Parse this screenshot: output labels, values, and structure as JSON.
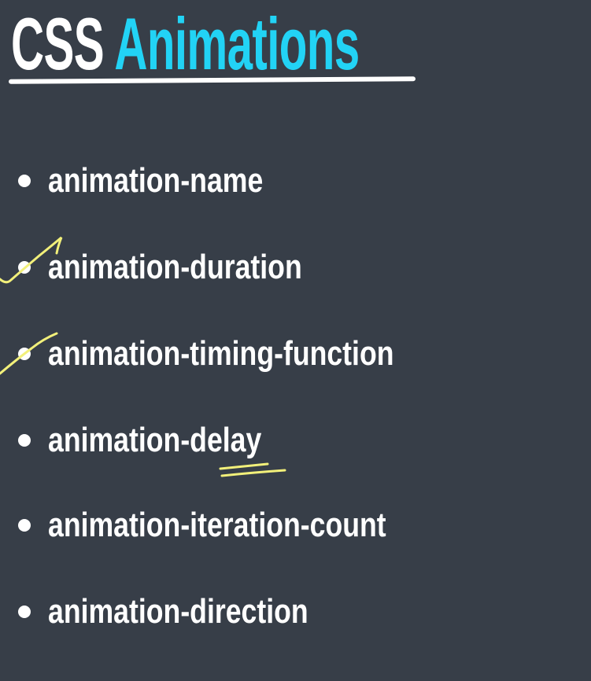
{
  "slide": {
    "title_part1": "CSS",
    "title_part2": "Animations",
    "accent_color": "#22d3f5",
    "annotation_color": "#f2f07a",
    "items": [
      {
        "label": "animation-name",
        "checked": false
      },
      {
        "label": "animation-duration",
        "checked": true
      },
      {
        "label": "animation-timing-function",
        "checked": true
      },
      {
        "label": "animation-delay",
        "checked": false,
        "underlined": "delay"
      },
      {
        "label": "animation-iteration-count",
        "checked": false
      },
      {
        "label": "animation-direction",
        "checked": false
      }
    ]
  }
}
